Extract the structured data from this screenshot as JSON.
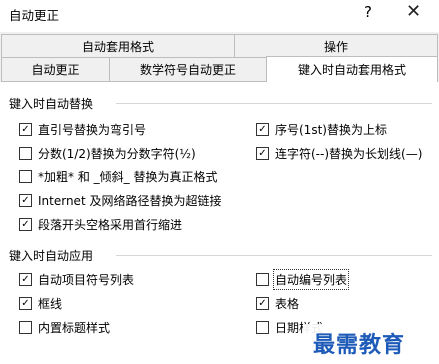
{
  "window": {
    "title": "自动更正",
    "help_label": "?",
    "close_label": "✕"
  },
  "tabs_back": [
    "自动套用格式",
    "操作"
  ],
  "tabs_front": [
    "自动更正",
    "数学符号自动更正",
    "键入时自动套用格式"
  ],
  "section1": {
    "title": "键入时自动替换",
    "options": [
      {
        "label": "直引号替换为弯引号",
        "checked": true
      },
      {
        "label": "序号(1st)替换为上标",
        "checked": true
      },
      {
        "label": "分数(1/2)替换为分数字符(½)",
        "checked": false
      },
      {
        "label": "连字符(--)替换为长划线(—)",
        "checked": true
      },
      {
        "label": "*加粗* 和 _倾斜_ 替换为真正格式",
        "checked": false
      },
      {
        "label": "Internet 及网络路径替换为超链接",
        "checked": true
      },
      {
        "label": "段落开头空格采用首行缩进",
        "checked": true
      }
    ]
  },
  "section2": {
    "title": "键入时自动应用",
    "options": [
      {
        "label": "自动项目符号列表",
        "checked": true
      },
      {
        "label": "自动编号列表",
        "checked": false
      },
      {
        "label": "框线",
        "checked": true
      },
      {
        "label": "表格",
        "checked": true
      },
      {
        "label": "内置标题样式",
        "checked": false
      },
      {
        "label": "日期样式",
        "checked": false
      }
    ]
  },
  "watermark": {
    "text": "最需教育"
  },
  "check_glyph": "✓"
}
